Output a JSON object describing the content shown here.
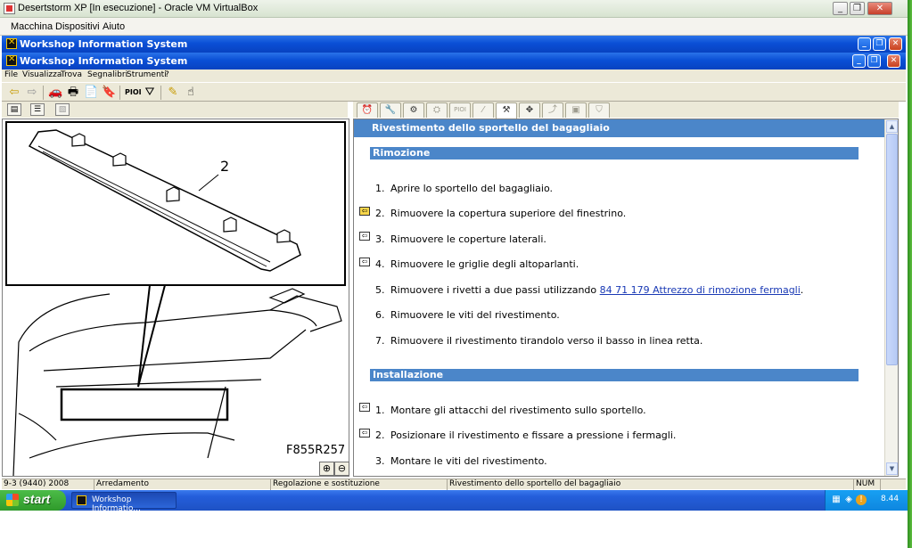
{
  "vbox": {
    "title": "Desertstorm XP [In esecuzione] - Oracle VM VirtualBox",
    "menu": [
      "Macchina",
      "Dispositivi",
      "Aiuto"
    ]
  },
  "outer_window": {
    "title": "Workshop Information System"
  },
  "inner_window": {
    "title": "Workshop Information System"
  },
  "app_menu": [
    "File",
    "Visualizza",
    "Trova",
    "Segnalibri",
    "Strumenti",
    "?"
  ],
  "toolbar": {
    "icons": [
      "back-arrow-icon",
      "forward-arrow-icon",
      "car-icon",
      "print-icon",
      "export-icon",
      "bookmark-icon",
      "binoculars-icon"
    ],
    "pioi_label": "PIOI",
    "icons2": [
      "filter-icon",
      "marker-icon",
      "pointer-hand-icon"
    ]
  },
  "right_tabs": {
    "pioi_label": "PIOI"
  },
  "figure": {
    "callout_number": "2",
    "figure_code": "F855R257"
  },
  "document": {
    "title": "Rivestimento dello sportello del bagagliaio",
    "removal": {
      "heading": "Rimozione",
      "steps": [
        {
          "num": "1.",
          "text": "Aprire lo sportello del bagagliaio."
        },
        {
          "num": "2.",
          "text": "Rimuovere la copertura superiore del finestrino."
        },
        {
          "num": "3.",
          "text": "Rimuovere le coperture laterali."
        },
        {
          "num": "4.",
          "text": "Rimuovere le griglie degli altoparlanti."
        },
        {
          "num": "5.",
          "text_before": "Rimuovere i rivetti a due passi utilizzando ",
          "link": "84 71 179 Attrezzo di rimozione fermagli",
          "text_after": "."
        },
        {
          "num": "6.",
          "text": "Rimuovere le viti del rivestimento."
        },
        {
          "num": "7.",
          "text": "Rimuovere il rivestimento tirandolo verso il basso in linea retta."
        }
      ]
    },
    "install": {
      "heading": "Installazione",
      "steps": [
        {
          "num": "1.",
          "text": "Montare gli attacchi del rivestimento sullo sportello."
        },
        {
          "num": "2.",
          "text": "Posizionare il rivestimento e fissare a pressione i fermagli."
        },
        {
          "num": "3.",
          "text": "Montare le viti del rivestimento."
        }
      ]
    }
  },
  "status_bar": {
    "vehicle": "9-3 (9440) 2008",
    "group": "Arredamento",
    "section": "Regolazione e sostituzione",
    "document": "Rivestimento dello sportello del bagagliaio",
    "numlock": "NUM"
  },
  "taskbar": {
    "start_label": "start",
    "task_label": "Workshop Informatio...",
    "clock": "8.44"
  }
}
